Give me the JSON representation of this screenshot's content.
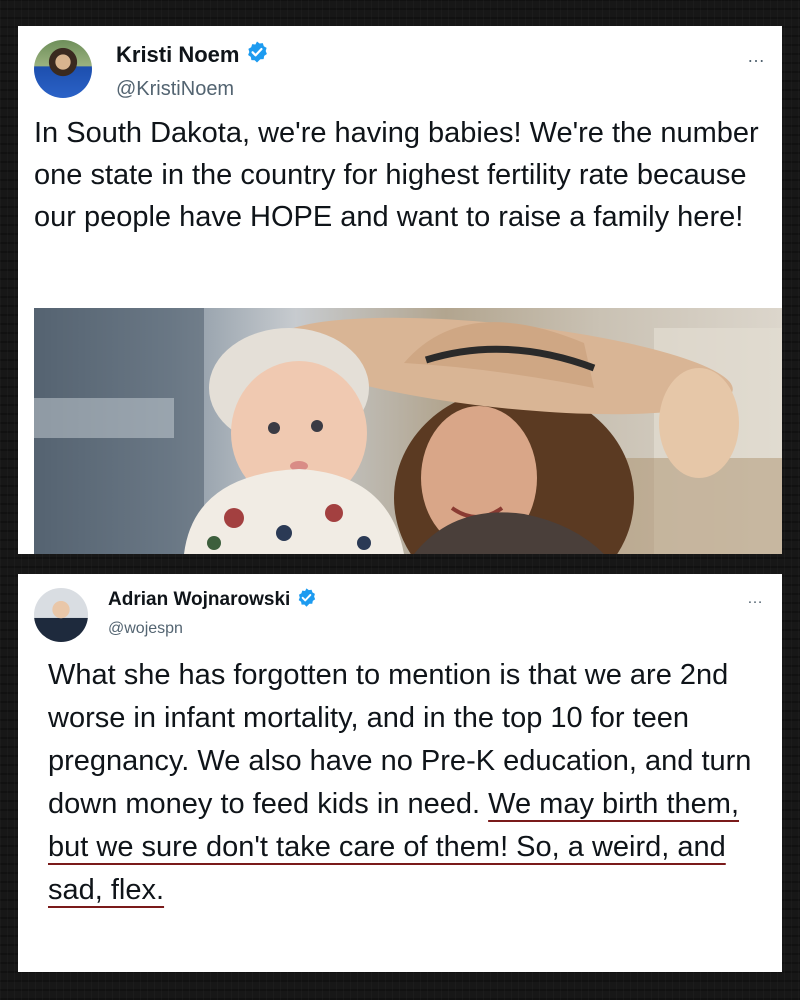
{
  "tweets": [
    {
      "display_name": "Kristi Noem",
      "handle": "@KristiNoem",
      "text": "In South Dakota, we're having babies! We're the number one state in the country for highest fertility rate because our people have HOPE and want to raise a family here!",
      "verified": true
    },
    {
      "display_name": "Adrian Wojnarowski",
      "handle": "@wojespn",
      "text_plain": "What she has forgotten to mention is that we are 2nd worse in infant mortality, and in the top 10 for teen pregnancy. We also have no Pre-K education, and turn down money to feed kids in need. ",
      "text_underlined": "We may birth them, but we sure don't take care of them! So, a weird, and sad, flex.",
      "verified": true
    }
  ],
  "more_glyph": "…",
  "colors": {
    "verified_blue": "#1d9bf0",
    "underline_red": "#7a1a1a",
    "text": "#0f1419",
    "secondary": "#536471"
  },
  "icons": {
    "verified": "verified-badge-icon",
    "more": "more-options-icon"
  }
}
